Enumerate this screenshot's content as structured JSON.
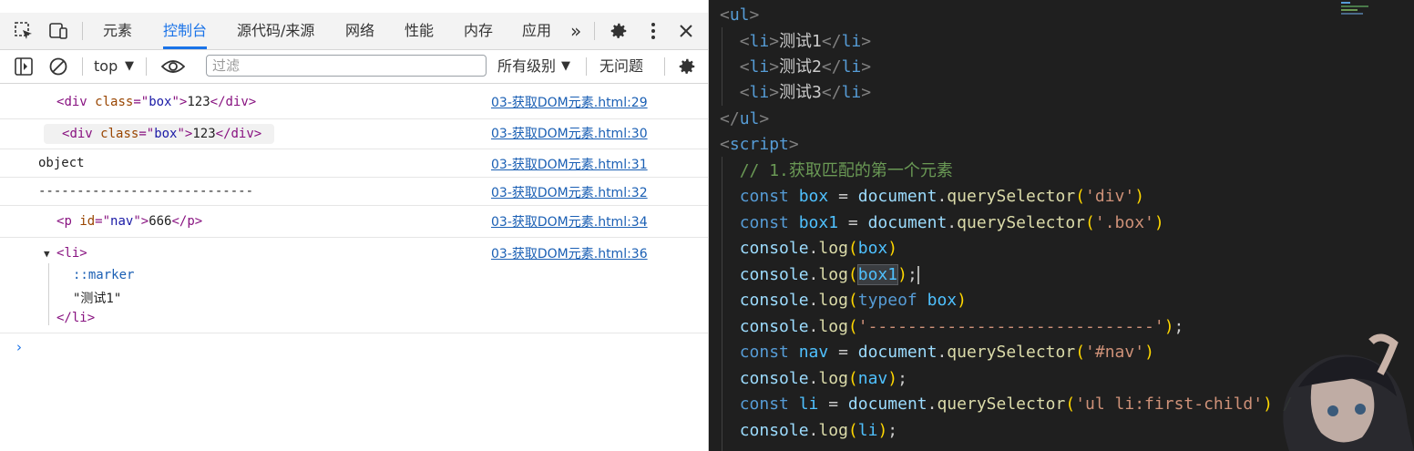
{
  "devtools": {
    "tabs": [
      {
        "label": "元素"
      },
      {
        "label": "控制台"
      },
      {
        "label": "源代码/来源"
      },
      {
        "label": "网络"
      },
      {
        "label": "性能"
      },
      {
        "label": "内存"
      },
      {
        "label": "应用"
      }
    ],
    "more_tabs_glyph": "»",
    "toolbar": {
      "context": "top",
      "filter_placeholder": "过滤",
      "levels": "所有级别",
      "issues": "无问题"
    },
    "console": [
      {
        "tag": "div",
        "attr": "class",
        "val": "box",
        "text": "123",
        "source": "03-获取DOM元素.html:29"
      },
      {
        "tag": "div",
        "attr": "class",
        "val": "box",
        "text": "123",
        "source": "03-获取DOM元素.html:30"
      },
      {
        "plain": "object",
        "source": "03-获取DOM元素.html:31"
      },
      {
        "plain": "----------------------------",
        "source": "03-获取DOM元素.html:32"
      },
      {
        "tag": "p",
        "attr": "id",
        "val": "nav",
        "text": "666",
        "source": "03-获取DOM元素.html:34"
      },
      {
        "tag": "li",
        "marker": "::marker",
        "text": "\"测试1\"",
        "source": "03-获取DOM元素.html:36"
      }
    ],
    "prompt": "›"
  },
  "editor": {
    "lines": [
      "<ul>",
      "  <li>测试1</li>",
      "  <li>测试2</li>",
      "  <li>测试3</li>",
      "</ul>",
      "<script>",
      "  // 1.获取匹配的第一个元素",
      "  const box = document.querySelector('div')",
      "  const box1 = document.querySelector('.box')",
      "  console.log(box)",
      "  console.log(box1);",
      "  console.log(typeof box)",
      "  console.log('-----------------------------');",
      "  const nav = document.querySelector('#nav')",
      "  console.log(nav);",
      "  const li = document.querySelector('ul li:first-child') /",
      "  console.log(li);"
    ],
    "colors": {
      "background": "#1f1f1f",
      "keyword": "#569cd6",
      "string": "#ce9178",
      "comment": "#6a9955",
      "function": "#dcdcaa"
    }
  }
}
